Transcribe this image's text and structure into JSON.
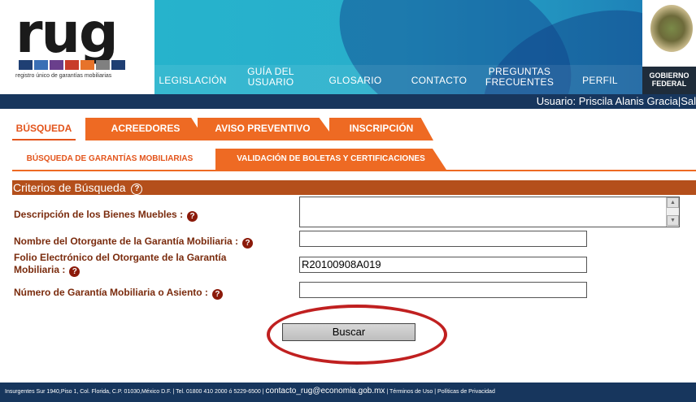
{
  "brand": {
    "logo_text": "rug",
    "tagline": "registro único de garantías mobiliarias",
    "square_colors": [
      "#1f3f73",
      "#3a6fb5",
      "#6a3f8c",
      "#c83c2a",
      "#e7732a",
      "#808080",
      "#1f3f73"
    ]
  },
  "menu": {
    "items": [
      {
        "label": "LEGISLACIÓN"
      },
      {
        "label": "GUÍA DEL\nUSUARIO"
      },
      {
        "label": "GLOSARIO"
      },
      {
        "label": "CONTACTO"
      },
      {
        "label": "PREGUNTAS\nFRECUENTES"
      },
      {
        "label": "PERFIL"
      }
    ]
  },
  "gov": {
    "line1": "GOBIERNO",
    "line2": "FEDERAL"
  },
  "user_bar": {
    "text": "Usuario: Priscila Alanis Gracia|Sal"
  },
  "tabs": [
    {
      "label": "BÚSQUEDA"
    },
    {
      "label": "ACREEDORES"
    },
    {
      "label": "AVISO PREVENTIVO"
    },
    {
      "label": "INSCRIPCIÓN"
    }
  ],
  "subtabs": [
    {
      "label": "BÚSQUEDA DE GARANTÍAS MOBILIARIAS"
    },
    {
      "label": "VALIDACIÓN DE BOLETAS Y CERTIFICACIONES"
    }
  ],
  "form": {
    "header": "Criterios de Búsqueda",
    "header_help_icon": "question-circle-icon",
    "fields": {
      "description": {
        "label": "Descripción de los Bienes Muebles :",
        "value": ""
      },
      "grantor_name": {
        "label": "Nombre del Otorgante de la Garantía Mobiliaria :",
        "value": ""
      },
      "grantor_folio": {
        "label_line1": "Folio Electrónico del Otorgante de la Garantía",
        "label_line2": "Mobiliaria :",
        "value": "R20100908A019"
      },
      "guarantee_number": {
        "label": "Número de Garantía Mobiliaria o Asiento :",
        "value": ""
      }
    },
    "help_glyph": "?",
    "submit_label": "Buscar"
  },
  "footer": {
    "address": "Insurgentes Sur 1940,Piso 1, Col. Florida, C.P. 01030,México D.F. | Tel. 01800 410 2000 ó 5229-6500 | ",
    "email": "contacto_rug@economia.gob.mx",
    "links": " | Términos de Uso | Políticas de Privacidad"
  },
  "colors": {
    "orange": "#ee6a23",
    "dark_orange": "#b44f1b",
    "navy": "#17365d",
    "label_red": "#7a2b0d"
  }
}
